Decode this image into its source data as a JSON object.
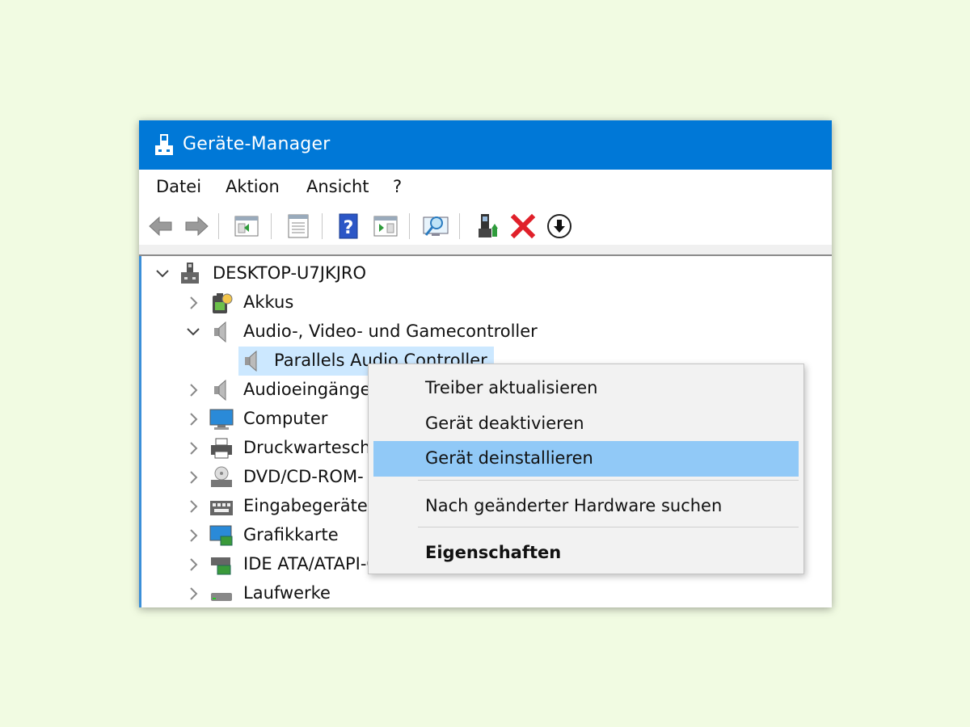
{
  "window": {
    "title": "Geräte-Manager"
  },
  "menu": {
    "items": [
      "Datei",
      "Aktion",
      "Ansicht",
      "?"
    ]
  },
  "toolbar": {
    "buttons": [
      "back-icon",
      "forward-icon",
      "console-tree-icon",
      "properties-icon",
      "help-icon",
      "action-pane-icon",
      "scan-hardware-icon",
      "update-driver-icon",
      "uninstall-icon",
      "disable-icon"
    ]
  },
  "tree": {
    "root": "DESKTOP-U7JKJRO",
    "items": [
      {
        "label": "Akkus",
        "icon": "battery-icon",
        "expanded": false
      },
      {
        "label": "Audio-, Video- und Gamecontroller",
        "icon": "speaker-icon",
        "expanded": true
      },
      {
        "label": "Parallels Audio Controller",
        "icon": "speaker-icon",
        "selected": true
      },
      {
        "label": "Audioeingänge",
        "icon": "speaker-icon",
        "expanded": false
      },
      {
        "label": "Computer",
        "icon": "monitor-icon",
        "expanded": false
      },
      {
        "label": "Druckwarteschl",
        "icon": "printer-icon",
        "expanded": false
      },
      {
        "label": "DVD/CD-ROM-",
        "icon": "disc-drive-icon",
        "expanded": false
      },
      {
        "label": "Eingabegeräte",
        "icon": "keyboard-icon",
        "expanded": false
      },
      {
        "label": "Grafikkarte",
        "icon": "display-adapter-icon",
        "expanded": false
      },
      {
        "label": "IDE ATA/ATAPI-C",
        "icon": "ide-controller-icon",
        "expanded": false
      },
      {
        "label": "Laufwerke",
        "icon": "drive-icon",
        "expanded": false
      }
    ]
  },
  "context_menu": {
    "items": [
      {
        "label": "Treiber aktualisieren"
      },
      {
        "label": "Gerät deaktivieren"
      },
      {
        "label": "Gerät deinstallieren",
        "highlighted": true
      },
      {
        "label": "Nach geänderter Hardware suchen"
      },
      {
        "label": "Eigenschaften",
        "bold": true
      }
    ]
  },
  "colors": {
    "titlebar": "#0078d7",
    "background": "#f1fbe2",
    "selection": "#cce8ff",
    "menu_highlight": "#91c9f7"
  }
}
